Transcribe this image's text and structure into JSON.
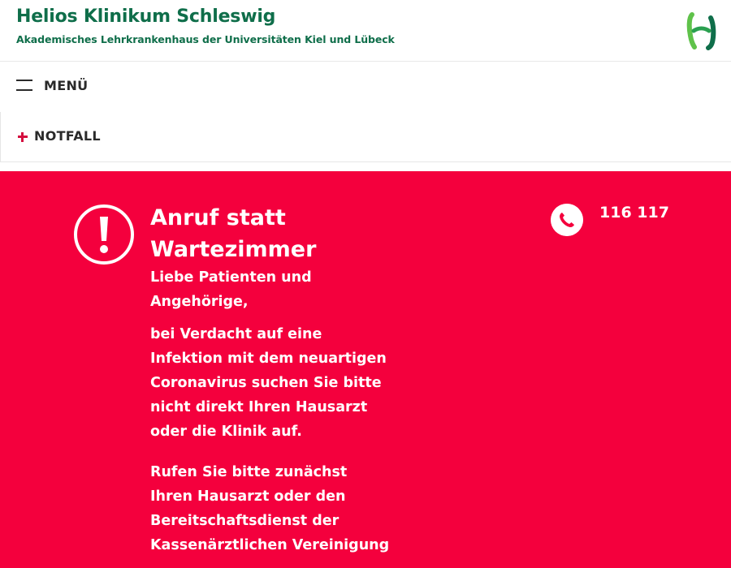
{
  "header": {
    "title": "Helios Klinikum Schleswig",
    "subtitle": "Akademisches Lehrkrankenhaus der Universitäten Kiel und Lübeck",
    "logo_icon": "helios-logo-icon",
    "brand_color": "#0f6e4a"
  },
  "nav": {
    "menu_label": "MENÜ",
    "notfall_label": "NOTFALL"
  },
  "alert": {
    "background_color": "#f4003d",
    "icon": "exclamation-icon",
    "title": "Anruf statt Wartezimmer",
    "greeting": "Liebe Patienten und Angehörige,",
    "paragraph_1": "bei Verdacht auf eine Infektion mit dem neuartigen Coronavirus suchen Sie bitte nicht direkt Ihren Hausarzt oder die Klinik auf.",
    "paragraph_2": "Rufen Sie bitte zunächst Ihren Hausarzt oder den Bereitschaftsdienst der Kassenärztlichen Vereinigung",
    "phone_icon": "phone-icon",
    "phone_number": "116 117"
  }
}
